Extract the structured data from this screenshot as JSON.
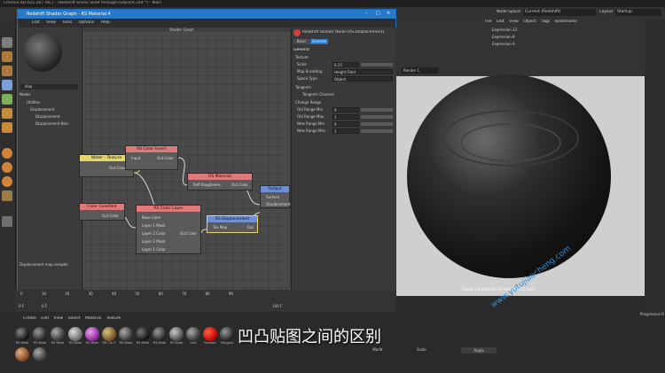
{
  "app": {
    "title": "Cinema 4D R21.207 (RC) - [Redshift Scene Shelf through-cutpoint.c4d *] - Main",
    "node_space_label": "Node Space",
    "node_space_value": "Current (Redshift)",
    "layout_label": "Layout",
    "layout_value": "Startup",
    "objects_menu": [
      "File",
      "Edit",
      "View",
      "Object",
      "Tags",
      "Bookmarks"
    ],
    "objects": [
      "Expression.13",
      "Expression.8",
      "Expression.9"
    ]
  },
  "shader_graph": {
    "window_title": "Redshift Shader Graph - RS Material.4",
    "menu": [
      "Edit",
      "View",
      "Tools",
      "Options",
      "Help"
    ],
    "canvas_title": "Shader Graph",
    "left_panel": {
      "search_placeholder": "disp",
      "nodes_header": "Nodes",
      "tree": [
        "Utilities",
        "Displacement",
        "Displacement",
        "Displacement Blen"
      ],
      "footer_label": "Displacement map sampler"
    },
    "nodes": {
      "water_texture": {
        "title": "Water - Texture",
        "out": "Out Color"
      },
      "color_invert": {
        "title": "RS Color Invert",
        "in": "Input",
        "out": "Out Color"
      },
      "rs_material": {
        "title": "RS Material",
        "in": "Refl Roughness",
        "out": "Out Color"
      },
      "output": {
        "title": "Output",
        "in1": "Surface",
        "in2": "Displacement"
      },
      "color_constant": {
        "title": "Color Constant",
        "out": "Out Color"
      },
      "color_layer": {
        "title": "RS Color Layer",
        "ports": [
          "Base Color",
          "Layer 1 Mask",
          "Layer 2 Color",
          "Layer 2 Mask",
          "Layer 1 Color"
        ],
        "out": "Out Color"
      },
      "displacement": {
        "title": "RS Displacement",
        "in": "Tex Map",
        "out": "Out"
      }
    },
    "properties": {
      "node_title": "Redshift Shader Node [RS Displacement]",
      "tabs": [
        "Basic",
        "General"
      ],
      "section_general": "General",
      "group_texture": "Texture",
      "rows_texture": [
        {
          "label": "Scale",
          "value": "0.25"
        },
        {
          "label": "Map Encoding",
          "value": "Height Field"
        },
        {
          "label": "Space Type",
          "value": "Object"
        }
      ],
      "group_tangents": "Tangents",
      "tangents_channel_label": "Tangents Channel",
      "group_range": "Change Range",
      "rows_range": [
        {
          "label": "Old Range Min",
          "value": "0"
        },
        {
          "label": "Old Range Max",
          "value": "1"
        },
        {
          "label": "New Range Min",
          "value": "0"
        },
        {
          "label": "New Range Max",
          "value": "1"
        }
      ]
    }
  },
  "viewport": {
    "renderer_label": "Render 1",
    "status_text": "Frame: 03   2020-04-13   18:04:52  (12.23s)"
  },
  "timeline": {
    "ticks": [
      "0",
      "10",
      "20",
      "30",
      "40",
      "50",
      "60",
      "70",
      "80",
      "90"
    ],
    "frame_start": "0 F",
    "frame_current": "0 F",
    "frame_end": "140 F"
  },
  "materials": {
    "menu": [
      "Create",
      "Edit",
      "View",
      "Select",
      "Material",
      "Texture"
    ],
    "items": [
      "RS Mate",
      "RS Mate",
      "RS Mate",
      "RS Mate",
      "RS Mate",
      "RS Car P",
      "RS Mate",
      "RS Mate",
      "RS Mate",
      "RS Mate",
      "RS Mate",
      "mtri",
      "Rsmate",
      "Polygon",
      "RS Mate"
    ]
  },
  "coordinates": {
    "apply_label": "Apply",
    "size_label": "Size",
    "world_label": "World",
    "scale_label": "Scale"
  },
  "attributes_label": "Progressive R",
  "subtitle": "凹凸贴图之间的区别",
  "watermark": "www.yutujiaocheng.com",
  "colors": {
    "accent_blue": "#2979c9",
    "node_red": "#e07a7a",
    "node_yellow": "#e6d56c",
    "node_blue": "#6f8fd2"
  }
}
